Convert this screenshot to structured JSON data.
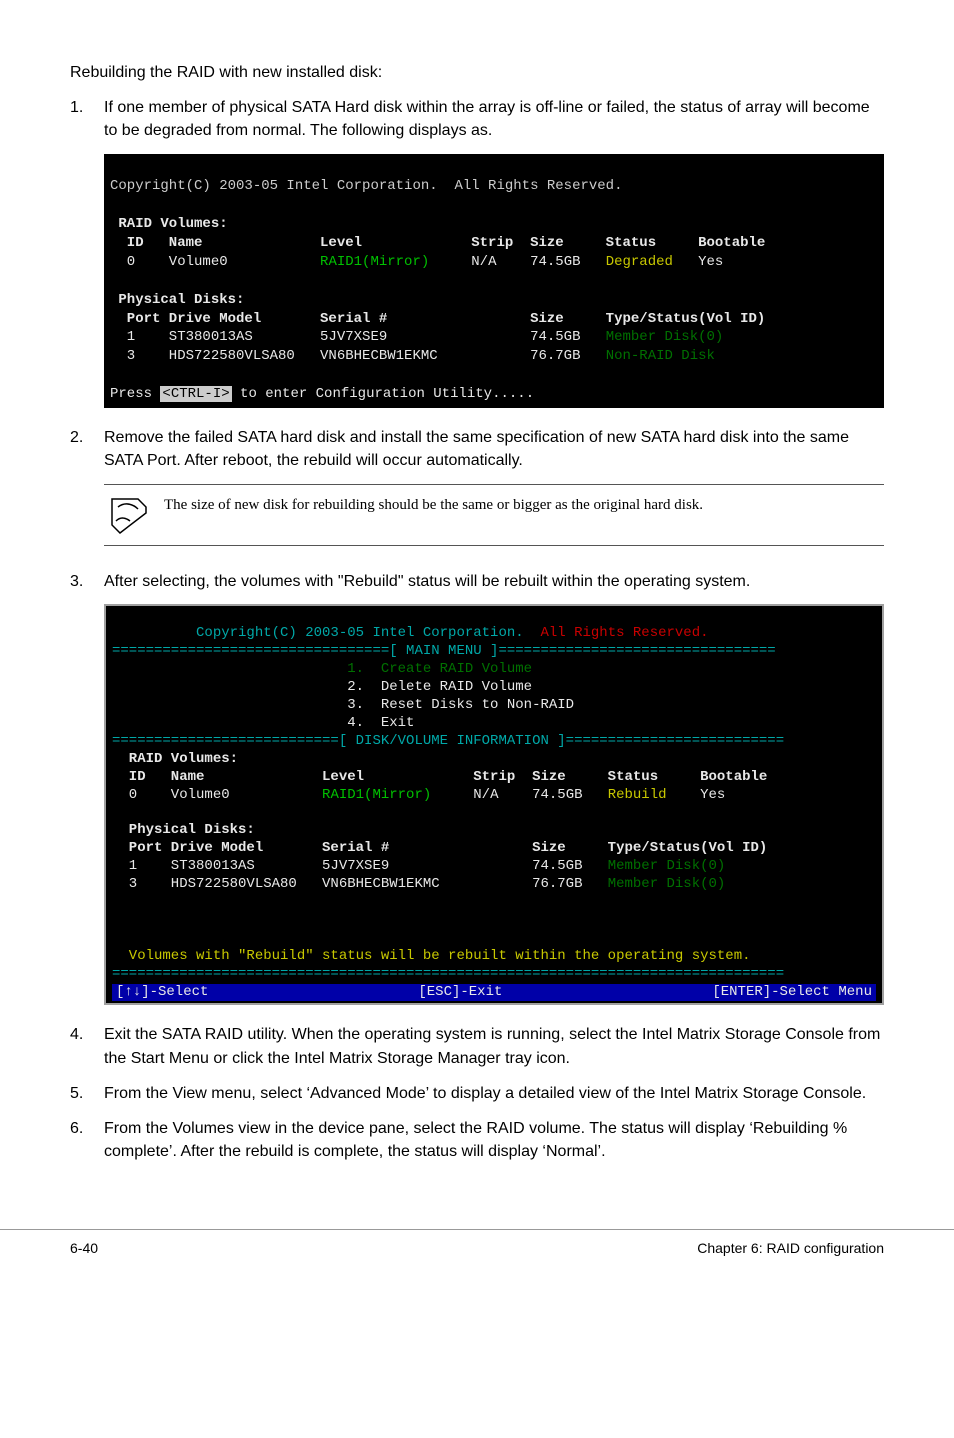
{
  "intro": "Rebuilding the RAID with new installed disk:",
  "steps": {
    "s1_num": "1.",
    "s1": "If one member of physical SATA Hard disk within the array is off-line or failed, the status of array will become to be degraded from normal. The following displays as.",
    "s2_num": "2.",
    "s2": "Remove the failed SATA hard disk and install the same specification of new SATA hard disk into the same SATA Port. After reboot, the rebuild will occur automatically.",
    "s3_num": "3.",
    "s3": "After selecting, the volumes with \"Rebuild\" status will be rebuilt within the operating system.",
    "s4_num": "4.",
    "s4": "Exit the SATA RAID utility. When the operating system is running, select the Intel Matrix Storage Console from the Start Menu or click the Intel Matrix Storage Manager tray icon.",
    "s5_num": "5.",
    "s5": "From the View menu, select ‘Advanced Mode’ to display a detailed view of the Intel Matrix Storage Console.",
    "s6_num": "6.",
    "s6": "From the Volumes view in the device pane, select the RAID volume. The status will display ‘Rebuilding % complete’. After the rebuild is complete, the status will display ‘Normal’."
  },
  "note": "The size of new disk for rebuilding should be the same or bigger as the original hard disk.",
  "term1": {
    "copyright": "Copyright(C) 2003-05 Intel Corporation.  All Rights Reserved.",
    "vol_header": " RAID Volumes:",
    "vol_cols": "  ID   Name              Level             Strip  Size     Status     Bootable",
    "vol_row0_a": "  0    Volume0           ",
    "vol_row0_b": "RAID1(Mirror)",
    "vol_row0_c": "     N/A    74.5GB   ",
    "vol_row0_status": "Degraded",
    "vol_row0_d": "   Yes",
    "phy_header": " Physical Disks:",
    "phy_cols": "  Port Drive Model       Serial #                 Size     Type/Status(Vol ID)",
    "phy_row1_a": "  1    ST380013AS        5JV7XSE9                 74.5GB   ",
    "phy_row1_b": "Member Disk(0)",
    "phy_row2_a": "  3    HDS722580VLSA80   VN6BHECBW1EKMC           76.7GB   ",
    "phy_row2_b": "Non-RAID Disk",
    "press_a": "Press ",
    "press_key": "<CTRL-I>",
    "press_b": " to enter Configuration Utility....."
  },
  "term2": {
    "copyright_a": "          Copyright(C) 2003-05 Intel Corporation.  ",
    "copyright_b": "All Rights Reserved.",
    "sec_top": "=================================[ MAIN MENU ]=================================",
    "menu1": "                            1.  Create RAID Volume",
    "menu2": "                            2.  Delete RAID Volume",
    "menu3": "                            3.  Reset Disks to Non-RAID",
    "menu4": "                            4.  Exit",
    "sec_mid": "===========================[ DISK/VOLUME INFORMATION ]==========================",
    "vol_header": "  RAID Volumes:",
    "vol_cols": "  ID   Name              Level             Strip  Size     Status     Bootable",
    "vol_row0_a": "  0    Volume0           ",
    "vol_row0_b": "RAID1(Mirror)",
    "vol_row0_c": "     N/A    74.5GB   ",
    "vol_row0_status": "Rebuild",
    "vol_row0_d": "    Yes",
    "phy_header": "  Physical Disks:",
    "phy_cols": "  Port Drive Model       Serial #                 Size     Type/Status(Vol ID)",
    "phy_row1_a": "  1    ST380013AS        5JV7XSE9                 74.5GB   ",
    "phy_row1_b": "Member Disk(0)",
    "phy_row2_a": "  3    HDS722580VLSA80   VN6BHECBW1EKMC           76.7GB   ",
    "phy_row2_b": "Member Disk(0)",
    "rebuild_msg": "  Volumes with \"Rebuild\" status will be rebuilt within the operating system.",
    "bar_left": "[↑↓]-Select",
    "bar_mid": "[ESC]-Exit",
    "bar_right": "[ENTER]-Select Menu"
  },
  "footer": {
    "left": "6-40",
    "right": "Chapter 6: RAID configuration"
  }
}
